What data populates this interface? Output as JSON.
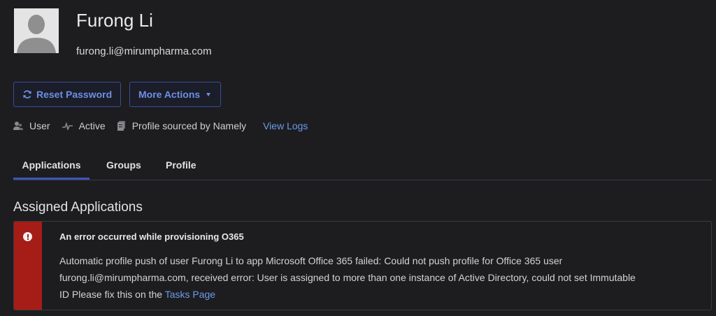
{
  "user": {
    "name": "Furong Li",
    "email": "furong.li@mirumpharma.com",
    "avatar_icon": "default-user-avatar-icon"
  },
  "actions": {
    "reset_password_label": "Reset Password",
    "reset_password_icon": "refresh-icon",
    "more_actions_label": "More Actions",
    "more_actions_icon": "caret-down-icon"
  },
  "meta": {
    "role_label": "User",
    "role_icon": "user-icon",
    "status_label": "Active",
    "status_icon": "pulse-icon",
    "source_label": "Profile sourced by Namely",
    "source_icon": "document-stack-icon",
    "view_logs_label": "View Logs"
  },
  "tabs": [
    {
      "label": "Applications",
      "active": true
    },
    {
      "label": "Groups",
      "active": false
    },
    {
      "label": "Profile",
      "active": false
    }
  ],
  "section": {
    "title": "Assigned Applications"
  },
  "error": {
    "title": "An error occurred while provisioning O365",
    "message_line1": "Automatic profile push of user Furong Li to app Microsoft Office 365 failed: Could not push profile for Office 365 user",
    "message_line2": "furong.li@mirumpharma.com, received error: User is assigned to more than one instance of Active Directory, could not set Immutable",
    "message_line3_prefix": "ID Please fix this on the",
    "link_label": "Tasks Page",
    "icon": "alert-circle-icon"
  },
  "colors": {
    "background": "#1d1d20",
    "accent": "#6c8fe6",
    "tab_underline": "#3e56b7",
    "error": "#a51d16",
    "link": "#6c9be8"
  }
}
